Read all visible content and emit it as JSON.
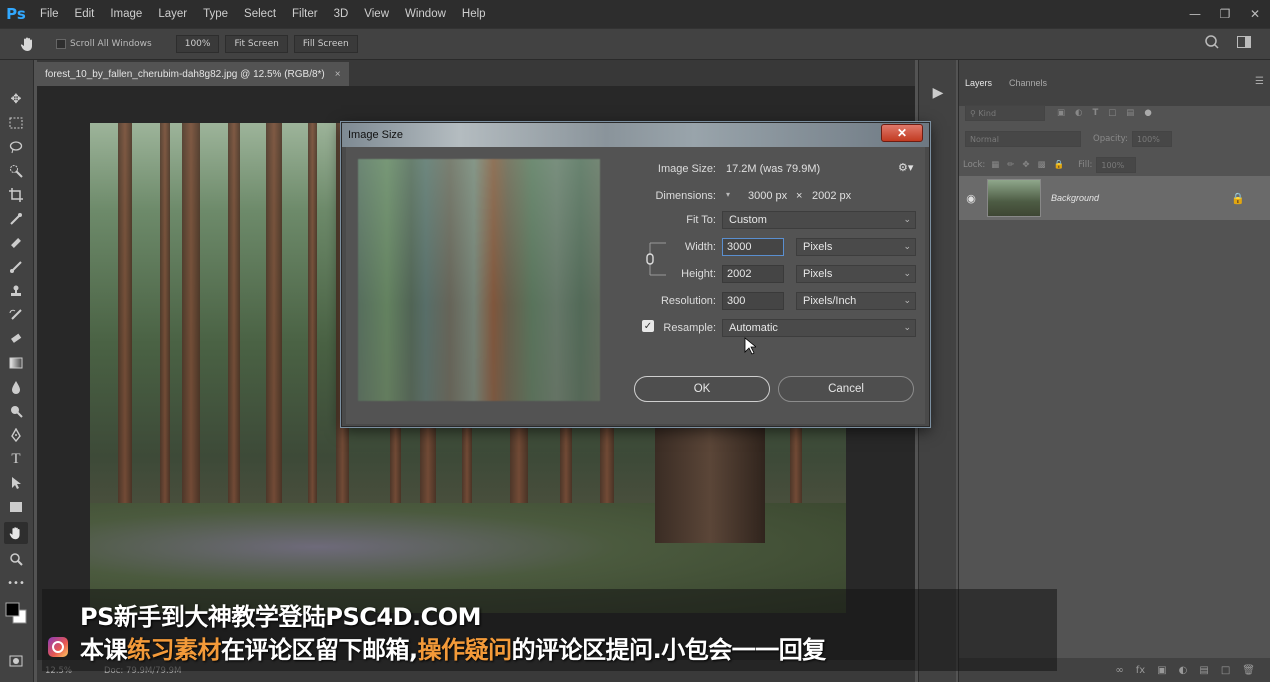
{
  "app": {
    "logo": "Ps"
  },
  "menu": [
    "File",
    "Edit",
    "Image",
    "Layer",
    "Type",
    "Select",
    "Filter",
    "3D",
    "View",
    "Window",
    "Help"
  ],
  "options_bar": {
    "scroll_all_windows": "Scroll All Windows",
    "zoom_btn": "100%",
    "fit_screen": "Fit Screen",
    "fill_screen": "Fill Screen"
  },
  "document": {
    "tab_title": "forest_10_by_fallen_cherubim-dah8g82.jpg @ 12.5% (RGB/8*)",
    "close_glyph": "×"
  },
  "status_bar": {
    "zoom": "12.5%",
    "doc": "Doc: 79.9M/79.9M"
  },
  "layers_panel": {
    "tabs": [
      "Layers",
      "Channels"
    ],
    "kind_placeholder": "Kind",
    "blend_mode": "Normal",
    "opacity_label": "Opacity:",
    "opacity_value": "100%",
    "lock_label": "Lock:",
    "fill_label": "Fill:",
    "fill_value": "100%",
    "layer_name": "Background"
  },
  "dialog": {
    "title": "Image Size",
    "close_glyph": "✕",
    "image_size_label": "Image Size:",
    "image_size_value": "17.2M (was 79.9M)",
    "dimensions_label": "Dimensions:",
    "dimensions_width": "3000 px",
    "dimensions_x": "×",
    "dimensions_height": "2002 px",
    "fit_to_label": "Fit To:",
    "fit_to_value": "Custom",
    "width_label": "Width:",
    "width_value": "3000",
    "width_unit": "Pixels",
    "height_label": "Height:",
    "height_value": "2002",
    "height_unit": "Pixels",
    "resolution_label": "Resolution:",
    "resolution_value": "300",
    "resolution_unit": "Pixels/Inch",
    "resample_label": "Resample:",
    "resample_value": "Automatic",
    "resample_checked": true,
    "ok_label": "OK",
    "cancel_label": "Cancel"
  },
  "subtitles": {
    "line1": "PS新手到大神教学登陆PSC4D.COM",
    "line2_a": "本课",
    "line2_b": "练习素材",
    "line2_c": "在评论区留下邮箱,",
    "line2_d": "操作疑问",
    "line2_e": "的评论区提问.小包会一一回复",
    "highlight_color": "#f39a39"
  }
}
